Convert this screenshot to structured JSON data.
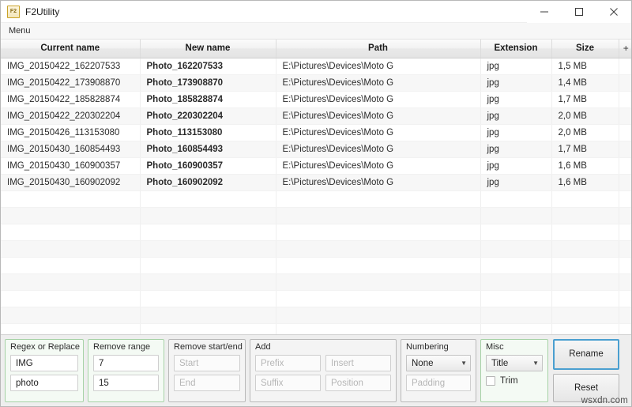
{
  "window": {
    "title": "F2Utility",
    "icon_label": "F2",
    "icon_name": "app-icon",
    "controls": [
      {
        "name": "minimize-button",
        "glyph": "–"
      },
      {
        "name": "maximize-button",
        "glyph": "□"
      },
      {
        "name": "close-button",
        "glyph": "✕"
      }
    ]
  },
  "menubar": {
    "items": [
      "Menu"
    ]
  },
  "table": {
    "columns": [
      "Current name",
      "New name",
      "Path",
      "Extension",
      "Size"
    ],
    "extra_column_label": "+",
    "rows": [
      {
        "current": "IMG_20150422_162207533",
        "new": "Photo_162207533",
        "path": "E:\\Pictures\\Devices\\Moto G",
        "ext": "jpg",
        "size": "1,5 MB"
      },
      {
        "current": "IMG_20150422_173908870",
        "new": "Photo_173908870",
        "path": "E:\\Pictures\\Devices\\Moto G",
        "ext": "jpg",
        "size": "1,4 MB"
      },
      {
        "current": "IMG_20150422_185828874",
        "new": "Photo_185828874",
        "path": "E:\\Pictures\\Devices\\Moto G",
        "ext": "jpg",
        "size": "1,7 MB"
      },
      {
        "current": "IMG_20150422_220302204",
        "new": "Photo_220302204",
        "path": "E:\\Pictures\\Devices\\Moto G",
        "ext": "jpg",
        "size": "2,0 MB"
      },
      {
        "current": "IMG_20150426_113153080",
        "new": "Photo_113153080",
        "path": "E:\\Pictures\\Devices\\Moto G",
        "ext": "jpg",
        "size": "2,0 MB"
      },
      {
        "current": "IMG_20150430_160854493",
        "new": "Photo_160854493",
        "path": "E:\\Pictures\\Devices\\Moto G",
        "ext": "jpg",
        "size": "1,7 MB"
      },
      {
        "current": "IMG_20150430_160900357",
        "new": "Photo_160900357",
        "path": "E:\\Pictures\\Devices\\Moto G",
        "ext": "jpg",
        "size": "1,6 MB"
      },
      {
        "current": "IMG_20150430_160902092",
        "new": "Photo_160902092",
        "path": "E:\\Pictures\\Devices\\Moto G",
        "ext": "jpg",
        "size": "1,6 MB"
      }
    ],
    "empty_row_count": 11
  },
  "panel": {
    "regex": {
      "title": "Regex or Replace",
      "find_value": "IMG",
      "find_placeholder": "",
      "replace_value": "photo",
      "replace_placeholder": ""
    },
    "remove_range": {
      "title": "Remove range",
      "from_value": "7",
      "to_value": "15"
    },
    "remove_start_end": {
      "title": "Remove start/end",
      "start_value": "",
      "start_placeholder": "Start",
      "end_value": "",
      "end_placeholder": "End"
    },
    "add": {
      "title": "Add",
      "prefix_value": "",
      "prefix_placeholder": "Prefix",
      "insert_value": "",
      "insert_placeholder": "Insert",
      "suffix_value": "",
      "suffix_placeholder": "Suffix",
      "position_value": "",
      "position_placeholder": "Position"
    },
    "numbering": {
      "title": "Numbering",
      "mode_value": "None",
      "padding_value": "",
      "padding_placeholder": "Padding"
    },
    "misc": {
      "title": "Misc",
      "case_value": "Title",
      "trim_label": "Trim",
      "trim_checked": false
    },
    "buttons": {
      "rename": "Rename",
      "reset": "Reset"
    }
  },
  "watermark": "wsxdn.com",
  "colors": {
    "new_name_green": "#15803d",
    "active_group_border": "#a6d2a6",
    "primary_button_border": "#4a9fd0"
  }
}
